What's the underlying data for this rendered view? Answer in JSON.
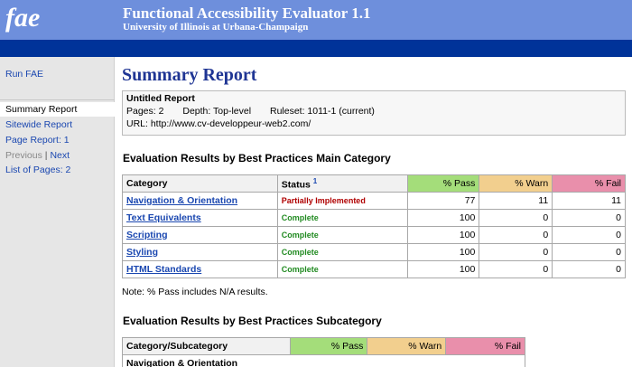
{
  "header": {
    "logo": "fae",
    "title": "Functional Accessibility Evaluator 1.1",
    "subtitle": "University of Illinois at Urbana-Champaign"
  },
  "sidebar": {
    "run": "Run FAE",
    "active": "Summary Report",
    "sitewide": "Sitewide Report",
    "page_report": "Page Report: 1",
    "previous": "Previous",
    "divider": "|",
    "next": "Next",
    "list_pages": "List of Pages: 2"
  },
  "main": {
    "title": "Summary Report",
    "report": {
      "name": "Untitled Report",
      "pages": "Pages: 2",
      "depth": "Depth: Top-level",
      "ruleset": "Ruleset: 1011-1 (current)",
      "url": "URL: http://www.cv-developpeur-web2.com/"
    },
    "main_section": {
      "title": "Evaluation Results by Best Practices Main Category",
      "headers": {
        "category": "Category",
        "status": "Status",
        "footnote": "1",
        "pass": "% Pass",
        "warn": "% Warn",
        "fail": "% Fail"
      },
      "rows": [
        {
          "category": "Navigation & Orientation",
          "status": "Partially Implemented",
          "pass": "77",
          "warn": "11",
          "fail": "11"
        },
        {
          "category": "Text Equivalents",
          "status": "Complete",
          "pass": "100",
          "warn": "0",
          "fail": "0"
        },
        {
          "category": "Scripting",
          "status": "Complete",
          "pass": "100",
          "warn": "0",
          "fail": "0"
        },
        {
          "category": "Styling",
          "status": "Complete",
          "pass": "100",
          "warn": "0",
          "fail": "0"
        },
        {
          "category": "HTML Standards",
          "status": "Complete",
          "pass": "100",
          "warn": "0",
          "fail": "0"
        }
      ],
      "note": "Note: % Pass includes N/A results."
    },
    "sub_section": {
      "title": "Evaluation Results by Best Practices Subcategory",
      "headers": {
        "category": "Category/Subcategory",
        "pass": "% Pass",
        "warn": "% Warn",
        "fail": "% Fail"
      },
      "first_group": "Navigation & Orientation"
    }
  },
  "colors": {
    "banner": "#6e8fdc",
    "navbar": "#003399",
    "pass": "#a4dd7a",
    "warn": "#f2cf8e",
    "fail": "#e98fab",
    "title": "#1f3594"
  }
}
